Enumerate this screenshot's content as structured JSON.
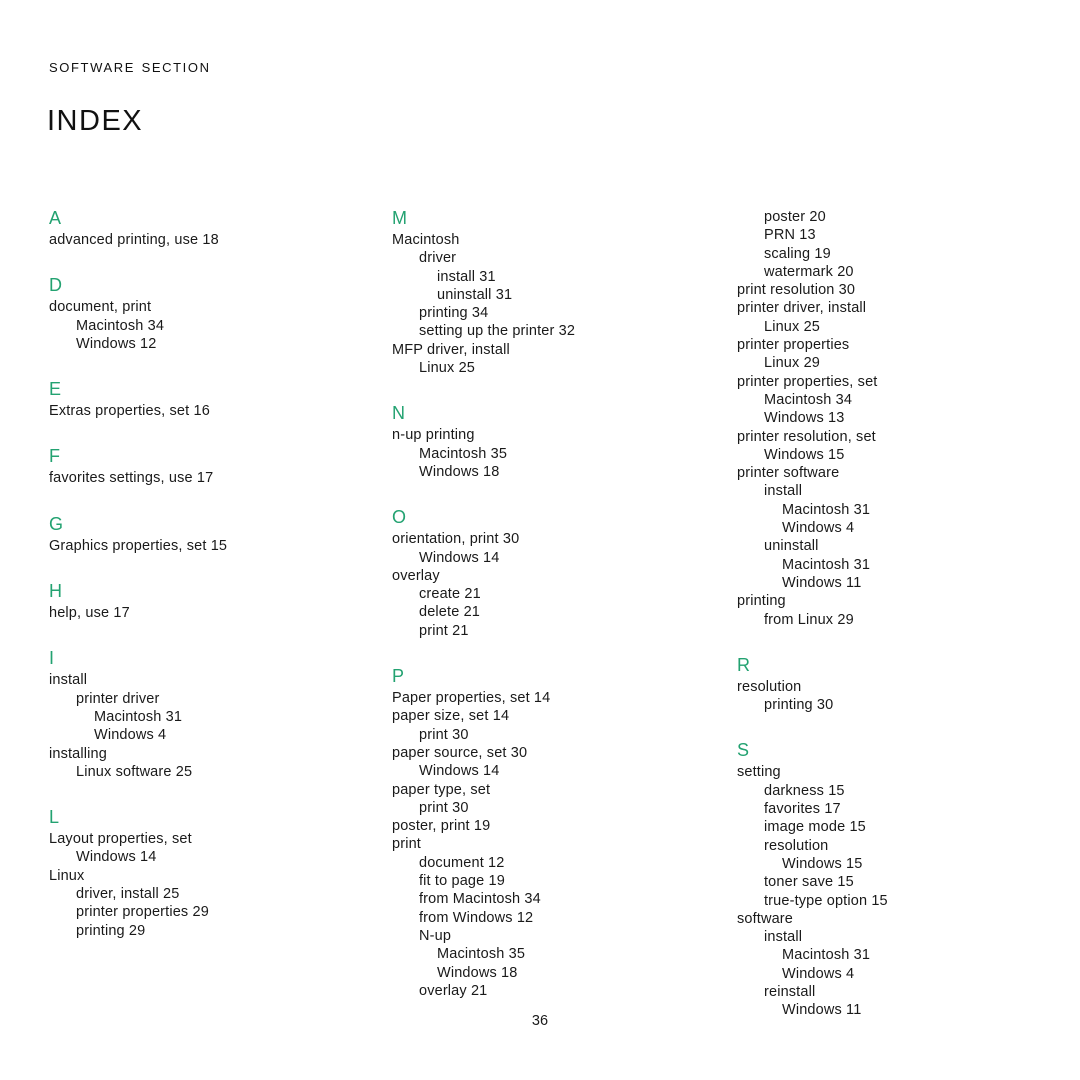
{
  "header": {
    "section_label": "Software Section",
    "title": "Index"
  },
  "accent_color": "#23a271",
  "text_color": "#1a1a1a",
  "footer": {
    "page_number": "36"
  },
  "columns": [
    {
      "groups": [
        {
          "letter": "A",
          "entries": [
            {
              "text": "advanced printing, use 18",
              "level": 0
            }
          ]
        },
        {
          "letter": "D",
          "entries": [
            {
              "text": "document, print",
              "level": 0
            },
            {
              "text": "Macintosh 34",
              "level": 1
            },
            {
              "text": "Windows 12",
              "level": 1
            }
          ]
        },
        {
          "letter": "E",
          "entries": [
            {
              "text": "Extras properties, set 16",
              "level": 0
            }
          ]
        },
        {
          "letter": "F",
          "entries": [
            {
              "text": "favorites settings, use 17",
              "level": 0
            }
          ]
        },
        {
          "letter": "G",
          "entries": [
            {
              "text": "Graphics properties, set 15",
              "level": 0
            }
          ]
        },
        {
          "letter": "H",
          "entries": [
            {
              "text": "help, use 17",
              "level": 0
            }
          ]
        },
        {
          "letter": "I",
          "entries": [
            {
              "text": "install",
              "level": 0
            },
            {
              "text": "printer driver",
              "level": 1
            },
            {
              "text": "Macintosh 31",
              "level": 2
            },
            {
              "text": "Windows 4",
              "level": 2
            },
            {
              "text": "installing",
              "level": 0
            },
            {
              "text": "Linux software 25",
              "level": 1
            }
          ]
        },
        {
          "letter": "L",
          "entries": [
            {
              "text": "Layout properties, set",
              "level": 0
            },
            {
              "text": "Windows 14",
              "level": 1
            },
            {
              "text": "Linux",
              "level": 0
            },
            {
              "text": "driver, install 25",
              "level": 1
            },
            {
              "text": "printer properties 29",
              "level": 1
            },
            {
              "text": "printing 29",
              "level": 1
            }
          ]
        }
      ]
    },
    {
      "groups": [
        {
          "letter": "M",
          "entries": [
            {
              "text": "Macintosh",
              "level": 0
            },
            {
              "text": "driver",
              "level": 1
            },
            {
              "text": "install 31",
              "level": 2
            },
            {
              "text": "uninstall 31",
              "level": 2
            },
            {
              "text": "printing 34",
              "level": 1
            },
            {
              "text": "setting up the printer 32",
              "level": 1
            },
            {
              "text": "MFP driver, install",
              "level": 0
            },
            {
              "text": "Linux 25",
              "level": 1
            }
          ]
        },
        {
          "letter": "N",
          "entries": [
            {
              "text": "n-up printing",
              "level": 0
            },
            {
              "text": "Macintosh 35",
              "level": 1
            },
            {
              "text": "Windows 18",
              "level": 1
            }
          ]
        },
        {
          "letter": "O",
          "entries": [
            {
              "text": "orientation, print 30",
              "level": 0
            },
            {
              "text": "Windows 14",
              "level": 1
            },
            {
              "text": "overlay",
              "level": 0
            },
            {
              "text": "create 21",
              "level": 1
            },
            {
              "text": "delete 21",
              "level": 1
            },
            {
              "text": "print 21",
              "level": 1
            }
          ]
        },
        {
          "letter": "P",
          "entries": [
            {
              "text": "Paper properties, set 14",
              "level": 0
            },
            {
              "text": "paper size, set 14",
              "level": 0
            },
            {
              "text": "print 30",
              "level": 1
            },
            {
              "text": "paper source, set 30",
              "level": 0
            },
            {
              "text": "Windows 14",
              "level": 1
            },
            {
              "text": "paper type, set",
              "level": 0
            },
            {
              "text": "print 30",
              "level": 1
            },
            {
              "text": "poster, print 19",
              "level": 0
            },
            {
              "text": "print",
              "level": 0
            },
            {
              "text": "document 12",
              "level": 1
            },
            {
              "text": "fit to page 19",
              "level": 1
            },
            {
              "text": "from Macintosh 34",
              "level": 1
            },
            {
              "text": "from Windows 12",
              "level": 1
            },
            {
              "text": "N-up",
              "level": 1
            },
            {
              "text": "Macintosh 35",
              "level": 2
            },
            {
              "text": "Windows 18",
              "level": 2
            },
            {
              "text": "overlay 21",
              "level": 1
            }
          ]
        }
      ]
    },
    {
      "groups": [
        {
          "letter": "",
          "entries": [
            {
              "text": "poster 20",
              "level": 1
            },
            {
              "text": "PRN 13",
              "level": 1
            },
            {
              "text": "scaling 19",
              "level": 1
            },
            {
              "text": "watermark 20",
              "level": 1
            },
            {
              "text": "print resolution 30",
              "level": 0
            },
            {
              "text": "printer driver, install",
              "level": 0
            },
            {
              "text": "Linux 25",
              "level": 1
            },
            {
              "text": "printer properties",
              "level": 0
            },
            {
              "text": "Linux 29",
              "level": 1
            },
            {
              "text": "printer properties, set",
              "level": 0
            },
            {
              "text": "Macintosh 34",
              "level": 1
            },
            {
              "text": "Windows 13",
              "level": 1
            },
            {
              "text": "printer resolution, set",
              "level": 0
            },
            {
              "text": "Windows 15",
              "level": 1
            },
            {
              "text": "printer software",
              "level": 0
            },
            {
              "text": "install",
              "level": 1
            },
            {
              "text": "Macintosh 31",
              "level": 2
            },
            {
              "text": "Windows 4",
              "level": 2
            },
            {
              "text": "uninstall",
              "level": 1
            },
            {
              "text": "Macintosh 31",
              "level": 2
            },
            {
              "text": "Windows 11",
              "level": 2
            },
            {
              "text": "printing",
              "level": 0
            },
            {
              "text": "from Linux 29",
              "level": 1
            }
          ]
        },
        {
          "letter": "R",
          "entries": [
            {
              "text": "resolution",
              "level": 0
            },
            {
              "text": "printing 30",
              "level": 1
            }
          ]
        },
        {
          "letter": "S",
          "entries": [
            {
              "text": "setting",
              "level": 0
            },
            {
              "text": "darkness 15",
              "level": 1
            },
            {
              "text": "favorites 17",
              "level": 1
            },
            {
              "text": "image mode 15",
              "level": 1
            },
            {
              "text": "resolution",
              "level": 1
            },
            {
              "text": "Windows 15",
              "level": 2
            },
            {
              "text": "toner save 15",
              "level": 1
            },
            {
              "text": "true-type option 15",
              "level": 1
            },
            {
              "text": "software",
              "level": 0
            },
            {
              "text": "install",
              "level": 1
            },
            {
              "text": "Macintosh 31",
              "level": 2
            },
            {
              "text": "Windows 4",
              "level": 2
            },
            {
              "text": "reinstall",
              "level": 1
            },
            {
              "text": "Windows 11",
              "level": 2
            }
          ]
        }
      ]
    }
  ]
}
